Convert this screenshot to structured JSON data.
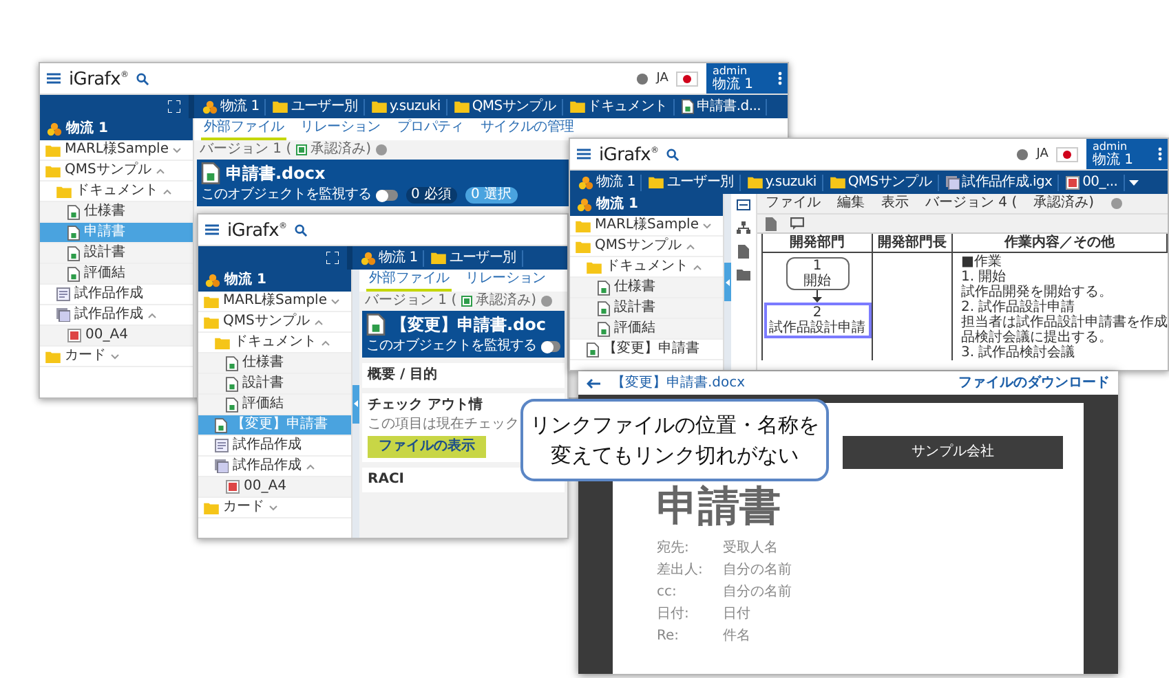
{
  "windows": [
    {
      "kind": "object_view",
      "top_bar": {
        "logo": "iGrafx$^{®}$",
        "language": "JA",
        "user": "admin",
        "user_org": "物流 1"
      },
      "breadcrumb": [
        {
          "label": "物流 1",
          "kind": "cluster"
        },
        {
          "label": "ユーザー別",
          "kind": "folder"
        },
        {
          "label": "y.suzuki",
          "kind": "folder"
        },
        {
          "label": "QMSサンプル",
          "kind": "folder"
        },
        {
          "label": "ドキュメント",
          "kind": "folder"
        },
        {
          "label": "申請書.d...",
          "kind": "document"
        }
      ],
      "tree_root": "物流 1",
      "tree": [
        {
          "label": "MARL様Sample",
          "kind": "folder",
          "expanded": false,
          "selected": false
        },
        {
          "label": "QMSサンプル",
          "kind": "folder",
          "expanded": true,
          "selected": false,
          "children": [
            {
              "label": "ドキュメント",
              "kind": "folder",
              "expanded": true,
              "selected": false,
              "children": [
                {
                  "label": "仕様書",
                  "kind": "document",
                  "selected": false
                },
                {
                  "label": "申請書",
                  "kind": "document",
                  "selected": true
                },
                {
                  "label": "設計書",
                  "kind": "document",
                  "selected": false
                },
                {
                  "label": "評価結",
                  "kind": "document",
                  "selected": false
                }
              ]
            },
            {
              "label": "試作品作成",
              "kind": "process",
              "selected": false
            },
            {
              "label": "試作品作成",
              "kind": "diagram",
              "expanded": true,
              "selected": false,
              "children": [
                {
                  "label": "00_A4",
                  "kind": "image",
                  "selected": false
                }
              ]
            }
          ]
        },
        {
          "label": "カード",
          "kind": "folder",
          "expanded": false,
          "selected": false
        }
      ],
      "tabs": [
        {
          "label": "外部ファイル",
          "selected": true
        },
        {
          "label": "リレーション",
          "selected": false
        },
        {
          "label": "プロパティ",
          "selected": false
        },
        {
          "label": "サイクルの管理",
          "selected": false
        }
      ],
      "version": "バージョン 1 (",
      "status": "承認済み)",
      "object": {
        "title": "申請書.docx",
        "watch_label": "このオブジェクトを監視する",
        "watch_on": false,
        "badges": [
          {
            "label": "0 必須",
            "active": false
          },
          {
            "label": "0 選択",
            "active": true
          }
        ]
      }
    },
    {
      "kind": "object_view",
      "collapse_handle": true,
      "top_bar": {
        "logo": "iGrafx$^{®}$"
      },
      "breadcrumb": [
        {
          "label": "物流 1",
          "kind": "cluster"
        },
        {
          "label": "ユーザー別",
          "kind": "folder"
        }
      ],
      "tree_root": "物流 1",
      "tree": [
        {
          "label": "MARL様Sample",
          "kind": "folder",
          "expanded": false,
          "selected": false
        },
        {
          "label": "QMSサンプル",
          "kind": "folder",
          "expanded": true,
          "selected": false,
          "children": [
            {
              "label": "ドキュメント",
              "kind": "folder",
              "expanded": true,
              "selected": false,
              "children": [
                {
                  "label": "仕様書",
                  "kind": "document",
                  "selected": false
                },
                {
                  "label": "設計書",
                  "kind": "document",
                  "selected": false
                },
                {
                  "label": "評価結",
                  "kind": "document",
                  "selected": false
                }
              ]
            },
            {
              "label": "【変更】申請書",
              "kind": "document",
              "selected": true
            },
            {
              "label": "試作品作成",
              "kind": "process",
              "selected": false
            },
            {
              "label": "試作品作成",
              "kind": "diagram",
              "expanded": true,
              "selected": false,
              "children": [
                {
                  "label": "00_A4",
                  "kind": "image",
                  "selected": false
                }
              ]
            }
          ]
        },
        {
          "label": "カード",
          "kind": "folder",
          "expanded": false,
          "selected": false
        }
      ],
      "tabs": [
        {
          "label": "外部ファイル",
          "selected": true
        },
        {
          "label": "リレーション",
          "selected": false
        }
      ],
      "version": "バージョン 1 (",
      "status": "承認済み)",
      "object": {
        "title": "【変更】申請書.doc",
        "watch_label": "このオブジェクトを監視する",
        "watch_on": false
      },
      "sections": [
        {
          "kind": "heading",
          "title": "概要 / 目的"
        },
        {
          "kind": "checkout",
          "title": "チェック アウト情",
          "text": "この項目は現在チェック",
          "button": "ファイルの表示"
        },
        {
          "kind": "heading",
          "title": "RACI"
        }
      ]
    },
    {
      "kind": "diagram_view",
      "collapse_handle": true,
      "top_bar": {
        "logo": "iGrafx$^{®}$",
        "language": "JA",
        "user": "admin",
        "user_org": "物流 1"
      },
      "breadcrumb": [
        {
          "label": "物流 1",
          "kind": "cluster"
        },
        {
          "label": "ユーザー別",
          "kind": "folder"
        },
        {
          "label": "y.suzuki",
          "kind": "folder"
        },
        {
          "label": "QMSサンプル",
          "kind": "folder"
        },
        {
          "label": "試作品作成.igx",
          "kind": "diagram"
        },
        {
          "label": "00_...",
          "kind": "image"
        }
      ],
      "tree_root": "物流 1",
      "tree": [
        {
          "label": "MARL様Sample",
          "kind": "folder",
          "expanded": false,
          "selected": false
        },
        {
          "label": "QMSサンプル",
          "kind": "folder",
          "expanded": true,
          "selected": false,
          "children": [
            {
              "label": "ドキュメント",
              "kind": "folder",
              "expanded": true,
              "selected": false,
              "children": [
                {
                  "label": "仕様書",
                  "kind": "document",
                  "selected": false
                },
                {
                  "label": "設計書",
                  "kind": "document",
                  "selected": false
                },
                {
                  "label": "評価結",
                  "kind": "document",
                  "selected": false
                }
              ]
            },
            {
              "label": "【変更】申請書",
              "kind": "document",
              "selected": false
            }
          ]
        }
      ],
      "menu": [
        "ファイル",
        "編集",
        "表示"
      ],
      "version": "バージョン 4 (",
      "status": "承認済み)",
      "diagram": {
        "columns": [
          "開発部門",
          "開発部門長",
          "作業内容／その他"
        ],
        "steps": [
          {
            "number": "1",
            "label": "開始",
            "selected": false
          },
          {
            "number": "2",
            "label": "試作品設計申請",
            "selected": true
          }
        ],
        "notes": [
          "■作業",
          "1. 開始",
          "試作品開発を開始する。",
          "2. 試作品設計申請",
          "担当者は試作品設計申請書を作成",
          "品検討会議に提出する。",
          "3. 試作品検討会議"
        ]
      }
    }
  ],
  "viewer": {
    "title": "【変更】申請書.docx",
    "download": "ファイルのダウンロード",
    "document": {
      "company": "サンプル会社",
      "heading": "申請書",
      "fields": [
        {
          "label": "宛先:",
          "value": "受取人名"
        },
        {
          "label": "差出人:",
          "value": "自分の名前"
        },
        {
          "label": "cc:",
          "value": "自分の名前"
        },
        {
          "label": "日付:",
          "value": "日付"
        },
        {
          "label": "Re:",
          "value": "件名"
        }
      ]
    }
  },
  "callout": {
    "lines": [
      "リンクファイルの位置・名称を",
      "変えてもリンク切れがない"
    ]
  }
}
